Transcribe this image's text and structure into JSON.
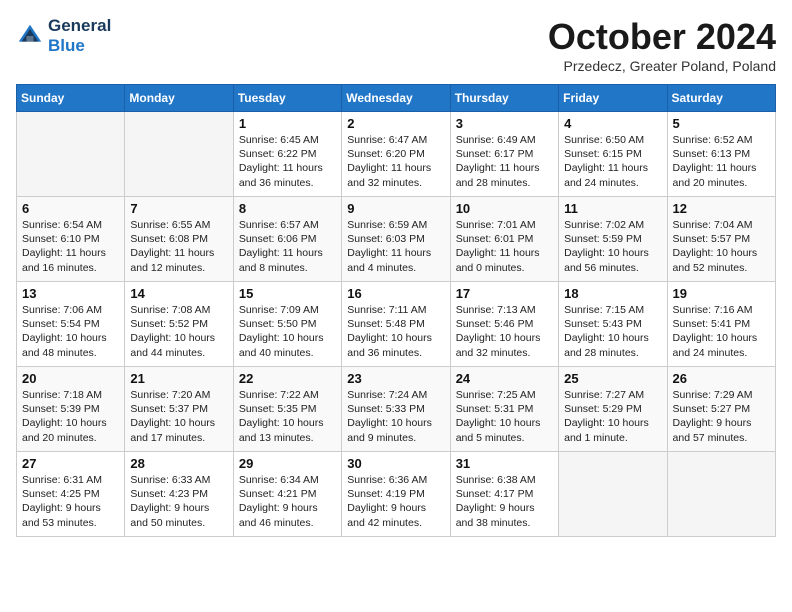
{
  "header": {
    "logo_line1": "General",
    "logo_line2": "Blue",
    "month_title": "October 2024",
    "subtitle": "Przedecz, Greater Poland, Poland"
  },
  "days_of_week": [
    "Sunday",
    "Monday",
    "Tuesday",
    "Wednesday",
    "Thursday",
    "Friday",
    "Saturday"
  ],
  "weeks": [
    [
      {
        "day": "",
        "info": ""
      },
      {
        "day": "",
        "info": ""
      },
      {
        "day": "1",
        "info": "Sunrise: 6:45 AM\nSunset: 6:22 PM\nDaylight: 11 hours\nand 36 minutes."
      },
      {
        "day": "2",
        "info": "Sunrise: 6:47 AM\nSunset: 6:20 PM\nDaylight: 11 hours\nand 32 minutes."
      },
      {
        "day": "3",
        "info": "Sunrise: 6:49 AM\nSunset: 6:17 PM\nDaylight: 11 hours\nand 28 minutes."
      },
      {
        "day": "4",
        "info": "Sunrise: 6:50 AM\nSunset: 6:15 PM\nDaylight: 11 hours\nand 24 minutes."
      },
      {
        "day": "5",
        "info": "Sunrise: 6:52 AM\nSunset: 6:13 PM\nDaylight: 11 hours\nand 20 minutes."
      }
    ],
    [
      {
        "day": "6",
        "info": "Sunrise: 6:54 AM\nSunset: 6:10 PM\nDaylight: 11 hours\nand 16 minutes."
      },
      {
        "day": "7",
        "info": "Sunrise: 6:55 AM\nSunset: 6:08 PM\nDaylight: 11 hours\nand 12 minutes."
      },
      {
        "day": "8",
        "info": "Sunrise: 6:57 AM\nSunset: 6:06 PM\nDaylight: 11 hours\nand 8 minutes."
      },
      {
        "day": "9",
        "info": "Sunrise: 6:59 AM\nSunset: 6:03 PM\nDaylight: 11 hours\nand 4 minutes."
      },
      {
        "day": "10",
        "info": "Sunrise: 7:01 AM\nSunset: 6:01 PM\nDaylight: 11 hours\nand 0 minutes."
      },
      {
        "day": "11",
        "info": "Sunrise: 7:02 AM\nSunset: 5:59 PM\nDaylight: 10 hours\nand 56 minutes."
      },
      {
        "day": "12",
        "info": "Sunrise: 7:04 AM\nSunset: 5:57 PM\nDaylight: 10 hours\nand 52 minutes."
      }
    ],
    [
      {
        "day": "13",
        "info": "Sunrise: 7:06 AM\nSunset: 5:54 PM\nDaylight: 10 hours\nand 48 minutes."
      },
      {
        "day": "14",
        "info": "Sunrise: 7:08 AM\nSunset: 5:52 PM\nDaylight: 10 hours\nand 44 minutes."
      },
      {
        "day": "15",
        "info": "Sunrise: 7:09 AM\nSunset: 5:50 PM\nDaylight: 10 hours\nand 40 minutes."
      },
      {
        "day": "16",
        "info": "Sunrise: 7:11 AM\nSunset: 5:48 PM\nDaylight: 10 hours\nand 36 minutes."
      },
      {
        "day": "17",
        "info": "Sunrise: 7:13 AM\nSunset: 5:46 PM\nDaylight: 10 hours\nand 32 minutes."
      },
      {
        "day": "18",
        "info": "Sunrise: 7:15 AM\nSunset: 5:43 PM\nDaylight: 10 hours\nand 28 minutes."
      },
      {
        "day": "19",
        "info": "Sunrise: 7:16 AM\nSunset: 5:41 PM\nDaylight: 10 hours\nand 24 minutes."
      }
    ],
    [
      {
        "day": "20",
        "info": "Sunrise: 7:18 AM\nSunset: 5:39 PM\nDaylight: 10 hours\nand 20 minutes."
      },
      {
        "day": "21",
        "info": "Sunrise: 7:20 AM\nSunset: 5:37 PM\nDaylight: 10 hours\nand 17 minutes."
      },
      {
        "day": "22",
        "info": "Sunrise: 7:22 AM\nSunset: 5:35 PM\nDaylight: 10 hours\nand 13 minutes."
      },
      {
        "day": "23",
        "info": "Sunrise: 7:24 AM\nSunset: 5:33 PM\nDaylight: 10 hours\nand 9 minutes."
      },
      {
        "day": "24",
        "info": "Sunrise: 7:25 AM\nSunset: 5:31 PM\nDaylight: 10 hours\nand 5 minutes."
      },
      {
        "day": "25",
        "info": "Sunrise: 7:27 AM\nSunset: 5:29 PM\nDaylight: 10 hours\nand 1 minute."
      },
      {
        "day": "26",
        "info": "Sunrise: 7:29 AM\nSunset: 5:27 PM\nDaylight: 9 hours\nand 57 minutes."
      }
    ],
    [
      {
        "day": "27",
        "info": "Sunrise: 6:31 AM\nSunset: 4:25 PM\nDaylight: 9 hours\nand 53 minutes."
      },
      {
        "day": "28",
        "info": "Sunrise: 6:33 AM\nSunset: 4:23 PM\nDaylight: 9 hours\nand 50 minutes."
      },
      {
        "day": "29",
        "info": "Sunrise: 6:34 AM\nSunset: 4:21 PM\nDaylight: 9 hours\nand 46 minutes."
      },
      {
        "day": "30",
        "info": "Sunrise: 6:36 AM\nSunset: 4:19 PM\nDaylight: 9 hours\nand 42 minutes."
      },
      {
        "day": "31",
        "info": "Sunrise: 6:38 AM\nSunset: 4:17 PM\nDaylight: 9 hours\nand 38 minutes."
      },
      {
        "day": "",
        "info": ""
      },
      {
        "day": "",
        "info": ""
      }
    ]
  ]
}
